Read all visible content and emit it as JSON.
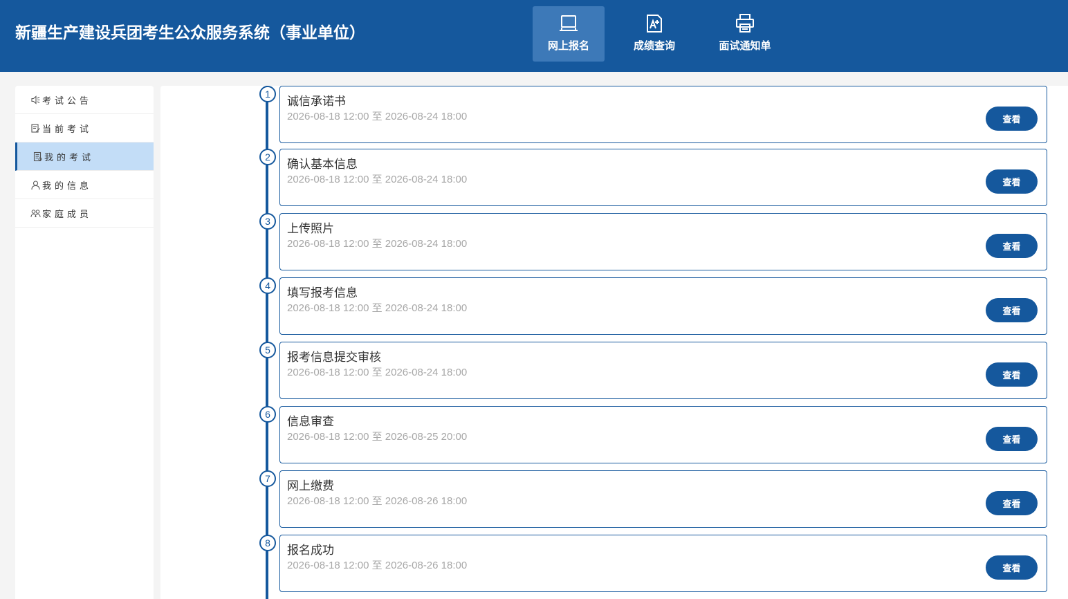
{
  "header": {
    "title": "新疆生产建设兵团考生公众服务系统（事业单位）",
    "nav": [
      {
        "label": "网上报名",
        "icon": "laptop-icon",
        "active": true
      },
      {
        "label": "成绩查询",
        "icon": "grade-document-icon",
        "active": false
      },
      {
        "label": "面试通知单",
        "icon": "printer-icon",
        "active": false
      }
    ],
    "colors": {
      "primary": "#15589d",
      "nav_active": "#3d79b8",
      "sidebar_active": "#c3ddf7"
    }
  },
  "sidebar": {
    "items": [
      {
        "label": "考试公告",
        "icon": "speaker-icon",
        "active": false
      },
      {
        "label": "当前考试",
        "icon": "edit-document-icon",
        "active": false
      },
      {
        "label": "我的考试",
        "icon": "document-icon",
        "active": true
      },
      {
        "label": "我的信息",
        "icon": "user-icon",
        "active": false
      },
      {
        "label": "家庭成员",
        "icon": "family-icon",
        "active": false
      }
    ]
  },
  "steps": [
    {
      "num": "1",
      "title": "诚信承诺书",
      "date": "2026-08-18 12:00 至 2026-08-24 18:00",
      "button": "查看"
    },
    {
      "num": "2",
      "title": "确认基本信息",
      "date": "2026-08-18 12:00 至 2026-08-24 18:00",
      "button": "查看"
    },
    {
      "num": "3",
      "title": "上传照片",
      "date": "2026-08-18 12:00 至 2026-08-24 18:00",
      "button": "查看"
    },
    {
      "num": "4",
      "title": "填写报考信息",
      "date": "2026-08-18 12:00 至 2026-08-24 18:00",
      "button": "查看"
    },
    {
      "num": "5",
      "title": "报考信息提交审核",
      "date": "2026-08-18 12:00 至 2026-08-24 18:00",
      "button": "查看"
    },
    {
      "num": "6",
      "title": "信息审查",
      "date": "2026-08-18 12:00 至 2026-08-25 20:00",
      "button": "查看"
    },
    {
      "num": "7",
      "title": "网上缴费",
      "date": "2026-08-18 12:00 至 2026-08-26 18:00",
      "button": "查看"
    },
    {
      "num": "8",
      "title": "报名成功",
      "date": "2026-08-18 12:00 至 2026-08-26 18:00",
      "button": "查看"
    }
  ]
}
